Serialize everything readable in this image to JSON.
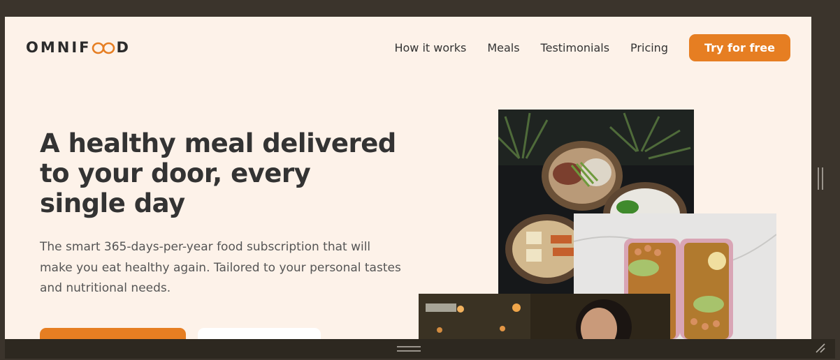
{
  "header": {
    "logo_text_before": "OMNIF",
    "logo_text_after": "D",
    "logo_icon": "infinity-loop-icon",
    "nav": [
      {
        "label": "How it works"
      },
      {
        "label": "Meals"
      },
      {
        "label": "Testimonials"
      },
      {
        "label": "Pricing"
      }
    ],
    "cta_label": "Try for free"
  },
  "hero": {
    "title": "A healthy meal delivered to your door, every single day",
    "description": "The smart 365-days-per-year food subscription that will make you eat healthy again. Tailored to your personal tastes and nutritional needs."
  },
  "colors": {
    "brand_orange": "#e67e22",
    "page_background": "#fdf2e9",
    "heading_text": "#333333",
    "window_frame": "#3b342c"
  }
}
